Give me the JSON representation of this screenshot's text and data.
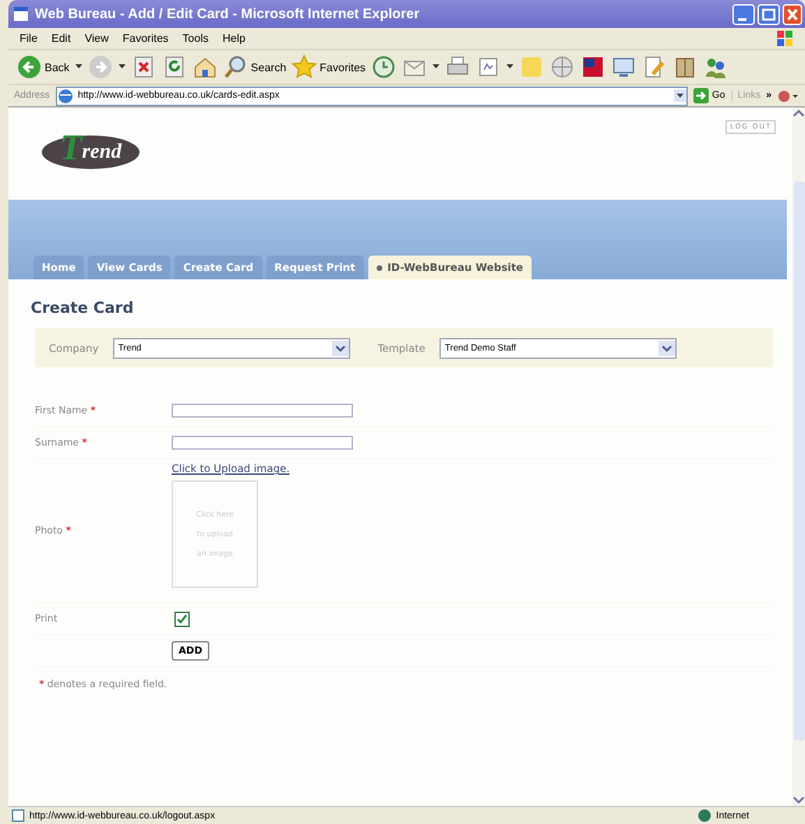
{
  "window": {
    "title": "Web Bureau - Add / Edit Card - Microsoft Internet Explorer"
  },
  "menu": [
    "File",
    "Edit",
    "View",
    "Favorites",
    "Tools",
    "Help"
  ],
  "toolbar": [
    {
      "kind": "back",
      "label": "Back",
      "dropdown": true
    },
    {
      "kind": "forward",
      "dropdown": true
    },
    {
      "kind": "stop"
    },
    {
      "kind": "refresh"
    },
    {
      "kind": "home"
    },
    {
      "kind": "search",
      "label": "Search"
    },
    {
      "kind": "favorites",
      "label": "Favorites"
    },
    {
      "kind": "history"
    },
    {
      "kind": "mail",
      "dropdown": true
    },
    {
      "kind": "print"
    },
    {
      "kind": "edit",
      "dropdown": true
    },
    {
      "kind": "note"
    },
    {
      "kind": "globe"
    },
    {
      "kind": "flag"
    },
    {
      "kind": "monitor"
    },
    {
      "kind": "pencil"
    },
    {
      "kind": "book"
    },
    {
      "kind": "people"
    }
  ],
  "address": {
    "label": "Address",
    "url": "http://www.id-webbureau.co.uk/cards-edit.aspx",
    "go": "Go",
    "links": "Links",
    "chevron": "»"
  },
  "page": {
    "logo": "rend",
    "logo_initial": "T",
    "logout": "LOG OUT",
    "tabs": [
      {
        "label": "Home",
        "selected": false
      },
      {
        "label": "View Cards",
        "selected": false
      },
      {
        "label": "Create Card",
        "selected": false
      },
      {
        "label": "Request Print",
        "selected": false
      },
      {
        "label": "ID-WebBureau Website",
        "selected": true
      }
    ],
    "heading": "Create Card",
    "filters": [
      {
        "label": "Company",
        "value": "Trend"
      },
      {
        "label": "Template",
        "value": "Trend Demo Staff"
      }
    ],
    "rows": [
      {
        "kind": "text",
        "label": "First Name",
        "mark": "*"
      },
      {
        "kind": "text",
        "label": "Surname",
        "mark": "*"
      },
      {
        "kind": "upload",
        "label": "Photo",
        "mark": "*",
        "link": "Click to Upload image.",
        "hint": [
          "Click here",
          "to upload",
          "an image"
        ]
      },
      {
        "kind": "checkbox",
        "label": "Print",
        "checked": true
      },
      {
        "kind": "button",
        "text": "ADD"
      }
    ],
    "note": {
      "mark": "*",
      "text": "denotes a required field."
    }
  },
  "status_bar": {
    "url": "http://www.id-webbureau.co.uk/logout.aspx",
    "zone": "Internet"
  }
}
